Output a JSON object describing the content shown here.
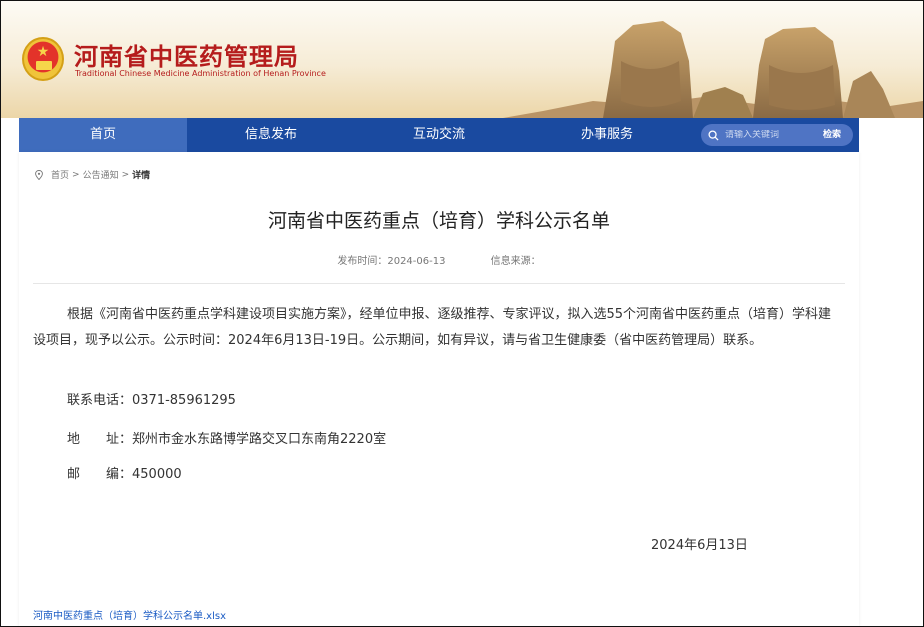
{
  "header": {
    "title": "河南省中医药管理局",
    "subtitle": "Traditional Chinese Medicine Administration of Henan Province"
  },
  "nav": {
    "items": [
      "首页",
      "信息发布",
      "互动交流",
      "办事服务"
    ],
    "active_index": 0,
    "search_placeholder": "请输入关键词",
    "search_button": "检索"
  },
  "breadcrumb": {
    "home": "首页",
    "section": "公告通知",
    "current": "详情",
    "separator": ">"
  },
  "article": {
    "title": "河南省中医药重点（培育）学科公示名单",
    "publish_time": "发布时间：2024-06-13",
    "source": "信息来源：",
    "body": "根据《河南省中医药重点学科建设项目实施方案》，经单位申报、逐级推荐、专家评议，拟入选55个河南省中医药重点（培育）学科建设项目，现予以公示。公示时间：2024年6月13日-19日。公示期间，如有异议，请与省卫生健康委（省中医药管理局）联系。",
    "phone": "联系电话：0371-85961295",
    "address": "地　　址：郑州市金水东路博学路交叉口东南角2220室",
    "postcode": "邮　　编：450000",
    "date": "2024年6月13日",
    "attachment": "河南中医药重点（培育）学科公示名单.xlsx"
  },
  "colors": {
    "nav_bg": "#1a4aa0",
    "nav_active": "#3f6cbd",
    "title_red": "#b51c1c",
    "link_blue": "#1a5bc4"
  }
}
